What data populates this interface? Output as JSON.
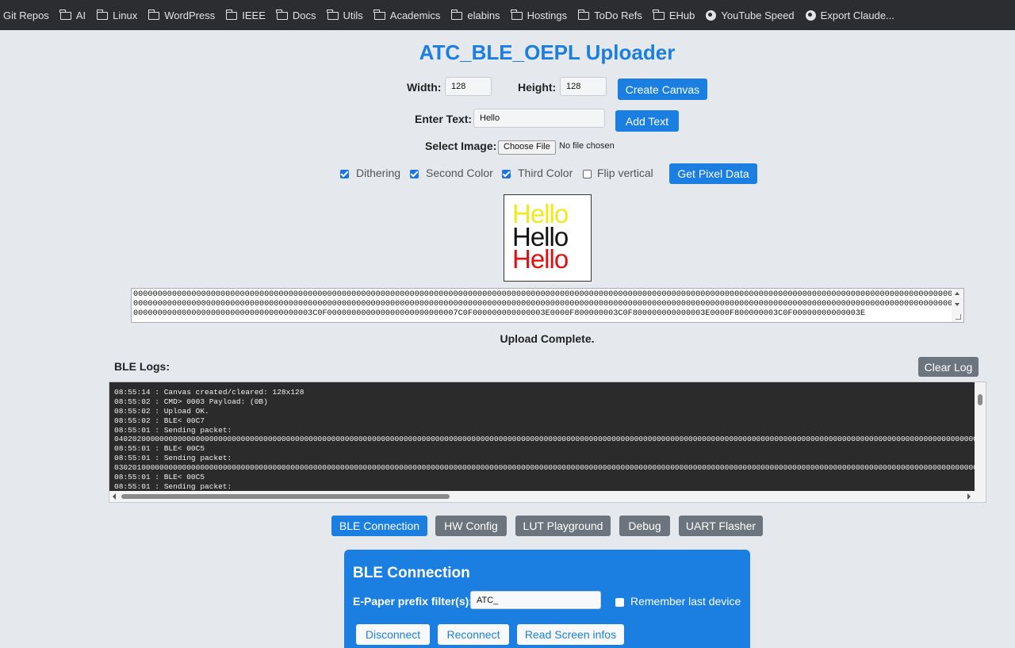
{
  "bookmarks": [
    {
      "label": "Git Repos",
      "icon": "none"
    },
    {
      "label": "AI",
      "icon": "folder-icon"
    },
    {
      "label": "Linux",
      "icon": "folder-icon"
    },
    {
      "label": "WordPress",
      "icon": "folder-icon"
    },
    {
      "label": "IEEE",
      "icon": "folder-icon"
    },
    {
      "label": "Docs",
      "icon": "folder-icon"
    },
    {
      "label": "Utils",
      "icon": "folder-icon"
    },
    {
      "label": "Academics",
      "icon": "folder-icon"
    },
    {
      "label": "elabins",
      "icon": "folder-icon"
    },
    {
      "label": "Hostings",
      "icon": "folder-icon"
    },
    {
      "label": "ToDo Refs",
      "icon": "folder-icon"
    },
    {
      "label": "EHub",
      "icon": "folder-icon"
    },
    {
      "label": "YouTube Speed",
      "icon": "globe-icon"
    },
    {
      "label": "Export Claude...",
      "icon": "globe-icon"
    }
  ],
  "app": {
    "title": "ATC_BLE_OEPL Uploader",
    "accent_color": "#1a7fe0"
  },
  "canvas_form": {
    "width_label": "Width:",
    "width_value": "128",
    "height_label": "Height:",
    "height_value": "128",
    "create_button": "Create Canvas",
    "text_label": "Enter Text:",
    "text_value": "Hello",
    "add_text_button": "Add Text",
    "image_label": "Select Image:",
    "choose_file_button": "Choose File",
    "file_status": "No file chosen"
  },
  "options": {
    "dithering": {
      "label": "Dithering",
      "checked": true
    },
    "second_color": {
      "label": "Second Color",
      "checked": true
    },
    "third_color": {
      "label": "Third Color",
      "checked": true
    },
    "flip_vertical": {
      "label": "Flip vertical",
      "checked": false
    },
    "pixel_button": "Get Pixel Data"
  },
  "preview": {
    "lines": [
      {
        "text": "Hello",
        "color": "#f2e81a"
      },
      {
        "text": "Hello",
        "color": "#111111"
      },
      {
        "text": "Hello",
        "color": "#e01010"
      }
    ]
  },
  "pixel_data": {
    "lines": [
      "0000000000000000000000000000000000000000000000000000000000000000000000000000000000000000000000000000000000000000000000000000000000000000000000000000000000000000000000000000000000000000000000000000",
      "0000000000000000000000000000000000000000000000000000000000000000000000000000000000000000000000000000000000000000000000000000000000000000000000000000000000000000000000000000000000000000000000000000",
      "0000000000000000000000000000000000003C0F000000000000000000000000007C0F000000000000003E0000F800000003C0F800000000000003E0000F800000003C0F00000000000003E"
    ]
  },
  "status": "Upload Complete.",
  "logs": {
    "title": "BLE Logs:",
    "clear_button": "Clear Log",
    "lines": [
      "08:55:14 : Canvas created/cleared: 128x128",
      "08:55:02 : CMD> 0003 Payload: (0B)",
      "08:55:02 : Upload OK.",
      "08:55:02 : BLE< 00C7",
      "08:55:01 : Sending packet:",
      "040202000000000000000000000000000000000000000000000000000000000000000000000000000000000000000000000000000000000000000000000000000000000000000000000000000000000000000000000000000000000000000000000000000000000000000000",
      "08:55:01 : BLE< 00C5",
      "08:55:01 : Sending packet:",
      "030201000000000000000000000000000000000000000000000000000000000000000000000000000000000000000000000000000000000000000000000000000000000000000000000000000000000000000000000000000000000000000000000000000000000000000000",
      "08:55:01 : BLE< 00C5",
      "08:55:01 : Sending packet:"
    ]
  },
  "tabs": [
    {
      "label": "BLE Connection",
      "active": true
    },
    {
      "label": "HW Config",
      "active": false
    },
    {
      "label": "LUT Playground",
      "active": false
    },
    {
      "label": "Debug",
      "active": false
    },
    {
      "label": "UART Flasher",
      "active": false
    }
  ],
  "ble_panel": {
    "title": "BLE Connection",
    "prefix_label": "E-Paper prefix filter(s):",
    "prefix_value": "ATC_",
    "remember_label": "Remember last device",
    "remember_checked": false,
    "disconnect_button": "Disconnect",
    "reconnect_button": "Reconnect",
    "read_button": "Read Screen infos"
  }
}
